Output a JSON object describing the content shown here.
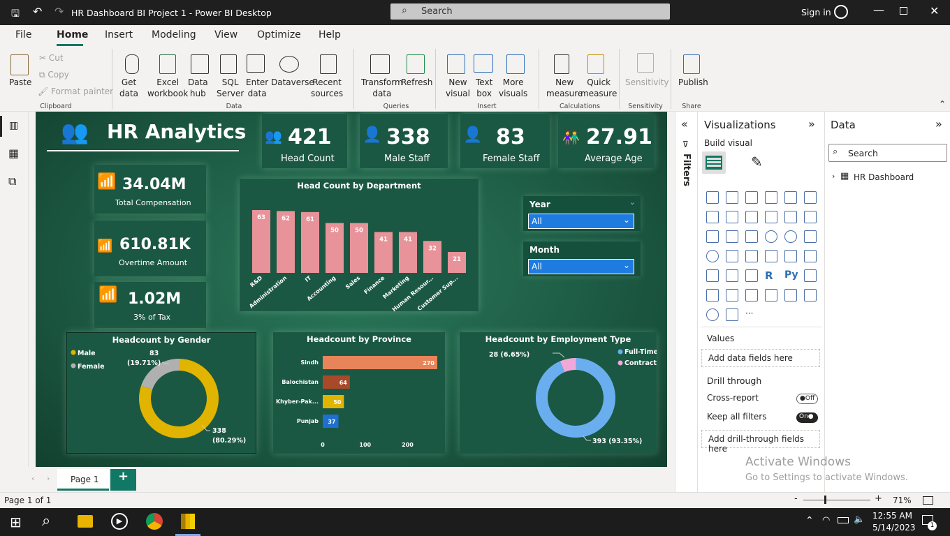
{
  "app": {
    "title": "HR Dashboard BI Project 1 - Power BI Desktop",
    "search_placeholder": "Search",
    "sign_in": "Sign in"
  },
  "menu": [
    "File",
    "Home",
    "Insert",
    "Modeling",
    "View",
    "Optimize",
    "Help"
  ],
  "ribbon": {
    "clipboard": {
      "paste": "Paste",
      "cut": "Cut",
      "copy": "Copy",
      "format_painter": "Format painter",
      "group": "Clipboard"
    },
    "data": {
      "get_data": "Get\ndata",
      "excel": "Excel\nworkbook",
      "datahub": "Data\nhub",
      "sql": "SQL\nServer",
      "enter": "Enter\ndata",
      "dataverse": "Dataverse",
      "recent": "Recent\nsources",
      "group": "Data"
    },
    "queries": {
      "transform": "Transform\ndata",
      "refresh": "Refresh",
      "group": "Queries"
    },
    "insert": {
      "new_visual": "New\nvisual",
      "text_box": "Text\nbox",
      "more_visuals": "More\nvisuals",
      "group": "Insert"
    },
    "calc": {
      "new_measure": "New\nmeasure",
      "quick_measure": "Quick\nmeasure",
      "group": "Calculations"
    },
    "sensitivity": {
      "label": "Sensitivity",
      "group": "Sensitivity"
    },
    "share": {
      "publish": "Publish",
      "group": "Share"
    }
  },
  "report": {
    "title": "HR Analytics",
    "kpis": [
      {
        "value": "421",
        "label": "Head Count"
      },
      {
        "value": "338",
        "label": "Male Staff"
      },
      {
        "value": "83",
        "label": "Female Staff"
      },
      {
        "value": "27.91",
        "label": "Average Age"
      }
    ],
    "side_kpis": [
      {
        "value": "34.04M",
        "label": "Total Compensation"
      },
      {
        "value": "610.81K",
        "label": "Overtime Amount"
      },
      {
        "value": "1.02M",
        "label": "3% of Tax"
      }
    ],
    "slicers": [
      {
        "title": "Year",
        "value": "All"
      },
      {
        "title": "Month",
        "value": "All"
      }
    ]
  },
  "chart_data": [
    {
      "type": "bar",
      "title": "Head Count by Department",
      "categories": [
        "R&D",
        "Administration",
        "IT",
        "Accounting",
        "Sales",
        "Finance",
        "Marketing",
        "Human Resour...",
        "Customer Sup..."
      ],
      "values": [
        63,
        62,
        61,
        50,
        50,
        41,
        41,
        32,
        21
      ],
      "color": "#e8939a"
    },
    {
      "type": "pie",
      "title": "Headcount by Gender",
      "labels": [
        "Male",
        "Female"
      ],
      "values": [
        338,
        83
      ],
      "data_labels": [
        "338\n(80.29%)",
        "83\n(19.71%)"
      ],
      "colors": [
        "#e0b400",
        "#b0b0b0"
      ],
      "legend": "top-left"
    },
    {
      "type": "bar",
      "orientation": "horizontal",
      "title": "Headcount by Province",
      "categories": [
        "Sindh",
        "Balochistan",
        "Khyber-Pak...",
        "Punjab"
      ],
      "values": [
        270,
        64,
        50,
        37
      ],
      "colors": [
        "#e8845a",
        "#a84a2a",
        "#e0b400",
        "#1f6fd0"
      ],
      "xticks": [
        "0",
        "100",
        "200"
      ],
      "xlim": [
        0,
        270
      ]
    },
    {
      "type": "pie",
      "title": "Headcount by Employment Type",
      "labels": [
        "Full-Time",
        "Contract"
      ],
      "values": [
        393,
        28
      ],
      "data_labels": [
        "393 (93.35%)",
        "28 (6.65%)"
      ],
      "colors": [
        "#6aaef0",
        "#f0a8d8"
      ],
      "legend": "top-right"
    }
  ],
  "filters": {
    "label": "Filters"
  },
  "viz_pane": {
    "title": "Visualizations",
    "build": "Build visual",
    "values": "Values",
    "values_well": "Add data fields here",
    "drill": "Drill through",
    "cross": "Cross-report",
    "cross_state": "Off",
    "keep": "Keep all filters",
    "keep_state": "On",
    "drill_well": "Add drill-through fields here"
  },
  "data_pane": {
    "title": "Data",
    "search": "Search",
    "table": "HR Dashboard"
  },
  "pages": {
    "tab": "Page 1",
    "add": "+"
  },
  "status": {
    "page": "Page 1 of 1",
    "zoom": "71%",
    "activate1": "Activate Windows",
    "activate2": "Go to Settings to activate Windows."
  },
  "taskbar": {
    "time": "12:55 AM",
    "date": "5/14/2023",
    "notif": "1"
  }
}
